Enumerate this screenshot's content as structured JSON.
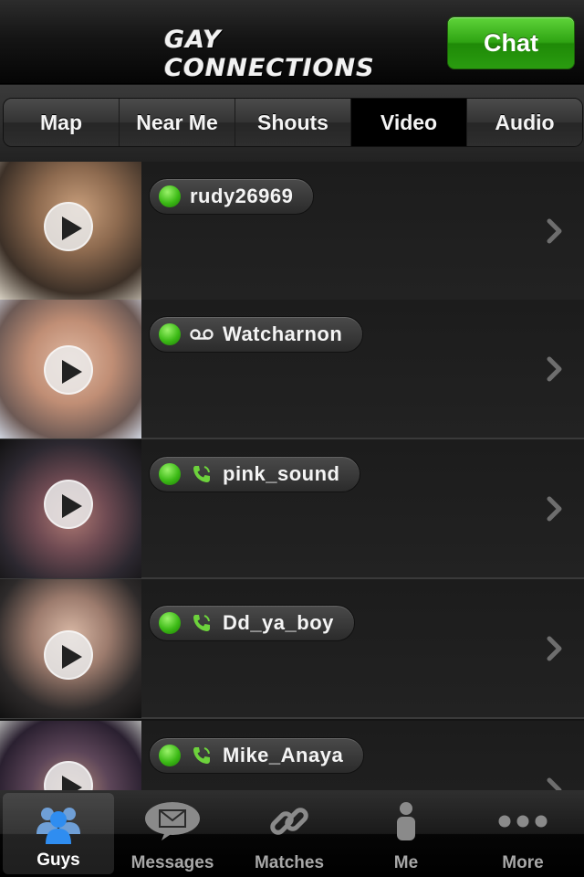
{
  "header": {
    "logo_text": "GAY CONNECTIONS",
    "chat_label": "Chat"
  },
  "tabs": [
    {
      "label": "Map",
      "active": false
    },
    {
      "label": "Near Me",
      "active": false
    },
    {
      "label": "Shouts",
      "active": false
    },
    {
      "label": "Video",
      "active": true
    },
    {
      "label": "Audio",
      "active": false
    }
  ],
  "users": [
    {
      "name": "rudy26969",
      "status": "online",
      "extra_icon": ""
    },
    {
      "name": "Watcharnon",
      "status": "online",
      "extra_icon": "voicemail-icon"
    },
    {
      "name": "pink_sound",
      "status": "online",
      "extra_icon": "phone-icon"
    },
    {
      "name": "Dd_ya_boy",
      "status": "online",
      "extra_icon": "phone-icon"
    },
    {
      "name": "Mike_Anaya",
      "status": "online",
      "extra_icon": "phone-icon"
    }
  ],
  "tabbar": [
    {
      "label": "Guys",
      "icon": "guys-icon",
      "active": true
    },
    {
      "label": "Messages",
      "icon": "envelope-icon",
      "active": false
    },
    {
      "label": "Matches",
      "icon": "chain-link-icon",
      "active": false
    },
    {
      "label": "Me",
      "icon": "person-icon",
      "active": false
    },
    {
      "label": "More",
      "icon": "more-dots-icon",
      "active": false
    }
  ],
  "colors": {
    "online": "#3cba16",
    "chat_button": "#2fa413",
    "accent_blue": "#3a8fe0"
  }
}
